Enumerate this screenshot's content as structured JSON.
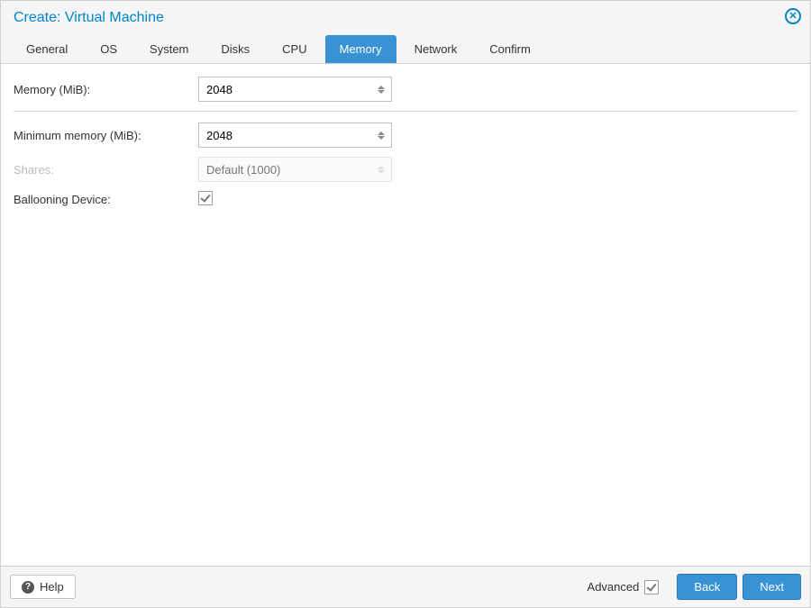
{
  "title": "Create: Virtual Machine",
  "tabs": [
    {
      "label": "General"
    },
    {
      "label": "OS"
    },
    {
      "label": "System"
    },
    {
      "label": "Disks"
    },
    {
      "label": "CPU"
    },
    {
      "label": "Memory",
      "active": true
    },
    {
      "label": "Network"
    },
    {
      "label": "Confirm"
    }
  ],
  "form": {
    "memory_label": "Memory (MiB):",
    "memory_value": "2048",
    "min_memory_label": "Minimum memory (MiB):",
    "min_memory_value": "2048",
    "shares_label": "Shares:",
    "shares_placeholder": "Default (1000)",
    "shares_disabled": true,
    "ballooning_label": "Ballooning Device:",
    "ballooning_checked": true
  },
  "footer": {
    "help_label": "Help",
    "advanced_label": "Advanced",
    "advanced_checked": true,
    "back_label": "Back",
    "next_label": "Next"
  }
}
